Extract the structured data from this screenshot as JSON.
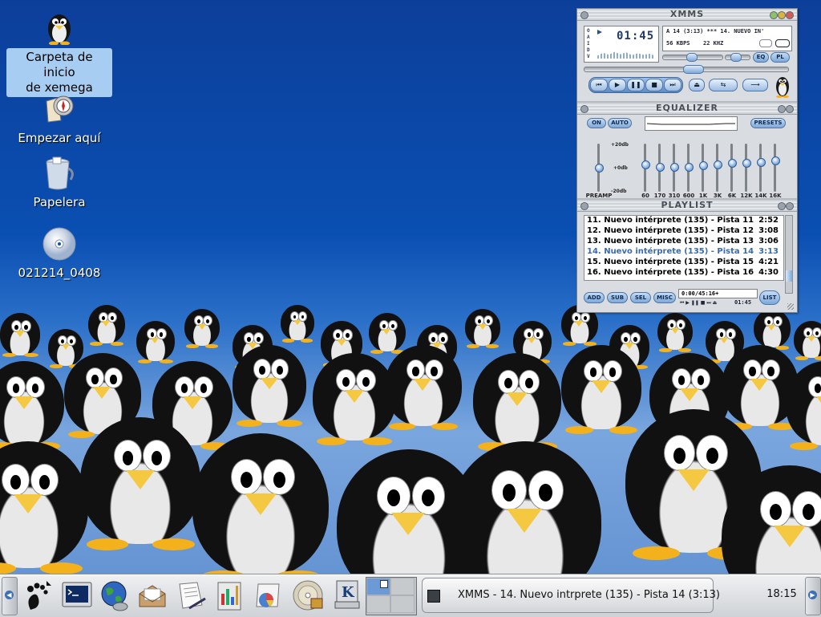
{
  "desktop": {
    "icons": [
      {
        "label_line1": "Carpeta de inicio",
        "label_line2": "de xemega",
        "icon": "penguin-home-icon"
      },
      {
        "label_line1": "Empezar aquí",
        "label_line2": "",
        "icon": "compass-icon"
      },
      {
        "label_line1": "Papelera",
        "label_line2": "",
        "icon": "trash-icon"
      },
      {
        "label_line1": "021214_0408",
        "label_line2": "",
        "icon": "cdrom-icon"
      }
    ]
  },
  "xmms": {
    "title": "XMMS",
    "time": "01:45",
    "song_title": "A 14 (3:13)  ***  14. NUEVO IN'",
    "kbps": "56 KBPS",
    "khz": "22 KHZ",
    "eq_button": "EQ",
    "pl_button": "PL",
    "status_letters": [
      "O",
      "A",
      "I",
      "D",
      "V"
    ],
    "equalizer": {
      "title": "EQUALIZER",
      "on_label": "ON",
      "auto_label": "AUTO",
      "presets_label": "PRESETS",
      "db_top": "+20db",
      "db_mid": "+0db",
      "db_bot": "-20db",
      "preamp_label": "PREAMP",
      "bands": [
        "60",
        "170",
        "310",
        "600",
        "1K",
        "3K",
        "6K",
        "12K",
        "14K",
        "16K"
      ],
      "band_levels": [
        0.15,
        0.05,
        0.05,
        0.05,
        0.1,
        0.15,
        0.2,
        0.2,
        0.25,
        0.3
      ],
      "preamp_level": 0.0
    },
    "playlist": {
      "title": "PLAYLIST",
      "items": [
        {
          "title": "11. Nuevo intérprete (135) - Pista 11",
          "duration": "2:52"
        },
        {
          "title": "12. Nuevo intérprete (135) - Pista 12",
          "duration": "3:08"
        },
        {
          "title": "13. Nuevo intérprete (135) - Pista 13",
          "duration": "3:06"
        },
        {
          "title": "14. Nuevo intérprete (135) - Pista 14",
          "duration": "3:13"
        },
        {
          "title": "15. Nuevo intérprete (135) - Pista 15",
          "duration": "4:21"
        },
        {
          "title": "16. Nuevo intérprete (135) - Pista 16",
          "duration": "4:30"
        }
      ],
      "current_index": 3,
      "add_label": "ADD",
      "sub_label": "SUB",
      "sel_label": "SEL",
      "misc_label": "MISC",
      "list_label": "LIST",
      "total_time": "0:00/45:16+",
      "mini_time": "01:45"
    }
  },
  "panel": {
    "launchers": [
      "gnome-foot-icon",
      "terminal-icon",
      "web-browser-icon",
      "mail-icon",
      "text-editor-icon",
      "presentation-icon",
      "spreadsheet-icon",
      "cd-player-icon",
      "kde-icon"
    ],
    "task_title": "XMMS - 14. Nuevo intrprete (135) - Pista 14 (3:13)",
    "clock": "18:15"
  },
  "colors": {
    "desktop_blue": "#0a4fb2",
    "selection": "#a8cdf2",
    "xmms_accent": "#7ea8d8",
    "current_track": "#3a6aa8"
  }
}
